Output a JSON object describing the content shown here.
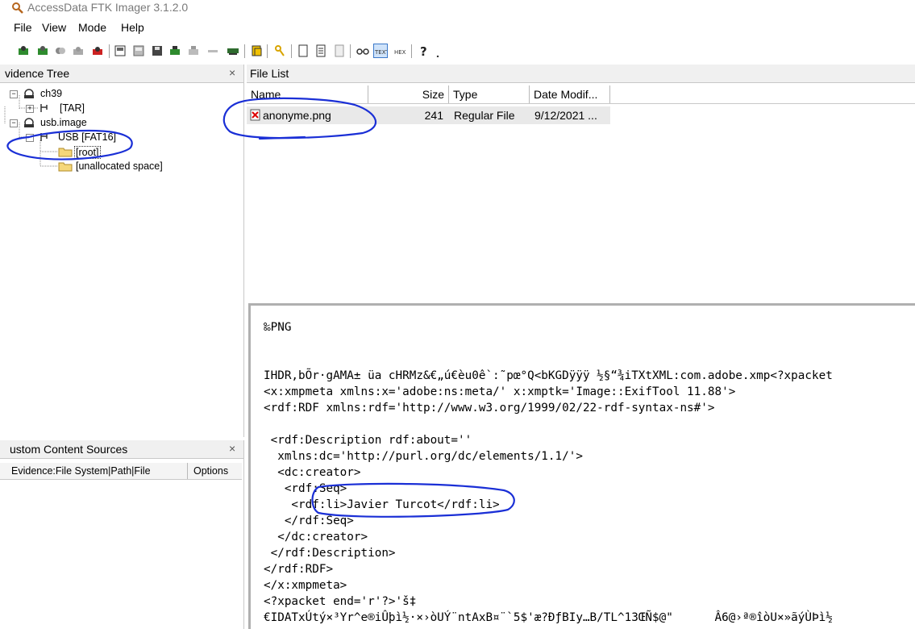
{
  "window": {
    "title": "AccessData FTK Imager 3.1.2.0"
  },
  "menu": {
    "file": "File",
    "view": "View",
    "mode": "Mode",
    "help": "Help"
  },
  "evidence_tree": {
    "title": "vidence Tree",
    "close": "×",
    "nodes": [
      "ch39",
      "[TAR]",
      "usb.image",
      "USB [FAT16]",
      "[root]",
      "[unallocated space]"
    ]
  },
  "custom_sources": {
    "title": "ustom Content Sources",
    "close": "×",
    "col_path": "Evidence:File System|Path|File",
    "col_options": "Options"
  },
  "file_list": {
    "title": "File List",
    "columns": {
      "name": "Name",
      "size": "Size",
      "type": "Type",
      "date": "Date Modif..."
    },
    "rows": [
      {
        "name": "anonyme.png",
        "size": "241",
        "type": "Regular File",
        "date": "9/12/2021 ..."
      }
    ]
  },
  "viewer": {
    "lines": [
      "‰PNG",
      "",
      "",
      "IHDR,bÕr·gAMA± üa cHRMz&€„ú€èu0ê`:˜pœ°Q<bKGDÿÿÿ ½§“¾iTXtXML:com.adobe.xmp<?xpacket",
      "<x:xmpmeta xmlns:x='adobe:ns:meta/' x:xmptk='Image::ExifTool 11.88'>",
      "<rdf:RDF xmlns:rdf='http://www.w3.org/1999/02/22-rdf-syntax-ns#'>",
      "",
      " <rdf:Description rdf:about=''",
      "  xmlns:dc='http://purl.org/dc/elements/1.1/'>",
      "  <dc:creator>",
      "   <rdf:Seq>",
      "    <rdf:li>Javier Turcot</rdf:li>",
      "   </rdf:Seq>",
      "  </dc:creator>",
      " </rdf:Description>",
      "</rdf:RDF>",
      "</x:xmpmeta>",
      "<?xpacket end='r'?>'š‡",
      "€IDATxÚtý×³Yr^e®iÛþì½·×›òUÝ¨ntAxB¤¨`5$'æ?ÐƒBIy…B/TL^13ŒÑ$@\"      Â6@›ª®îòU×»ãýÙÞì½"
    ]
  },
  "colors": {
    "annotation": "#1a2fd6",
    "selection": "#cfe3fa",
    "pane_bg": "#f0f0f0"
  }
}
